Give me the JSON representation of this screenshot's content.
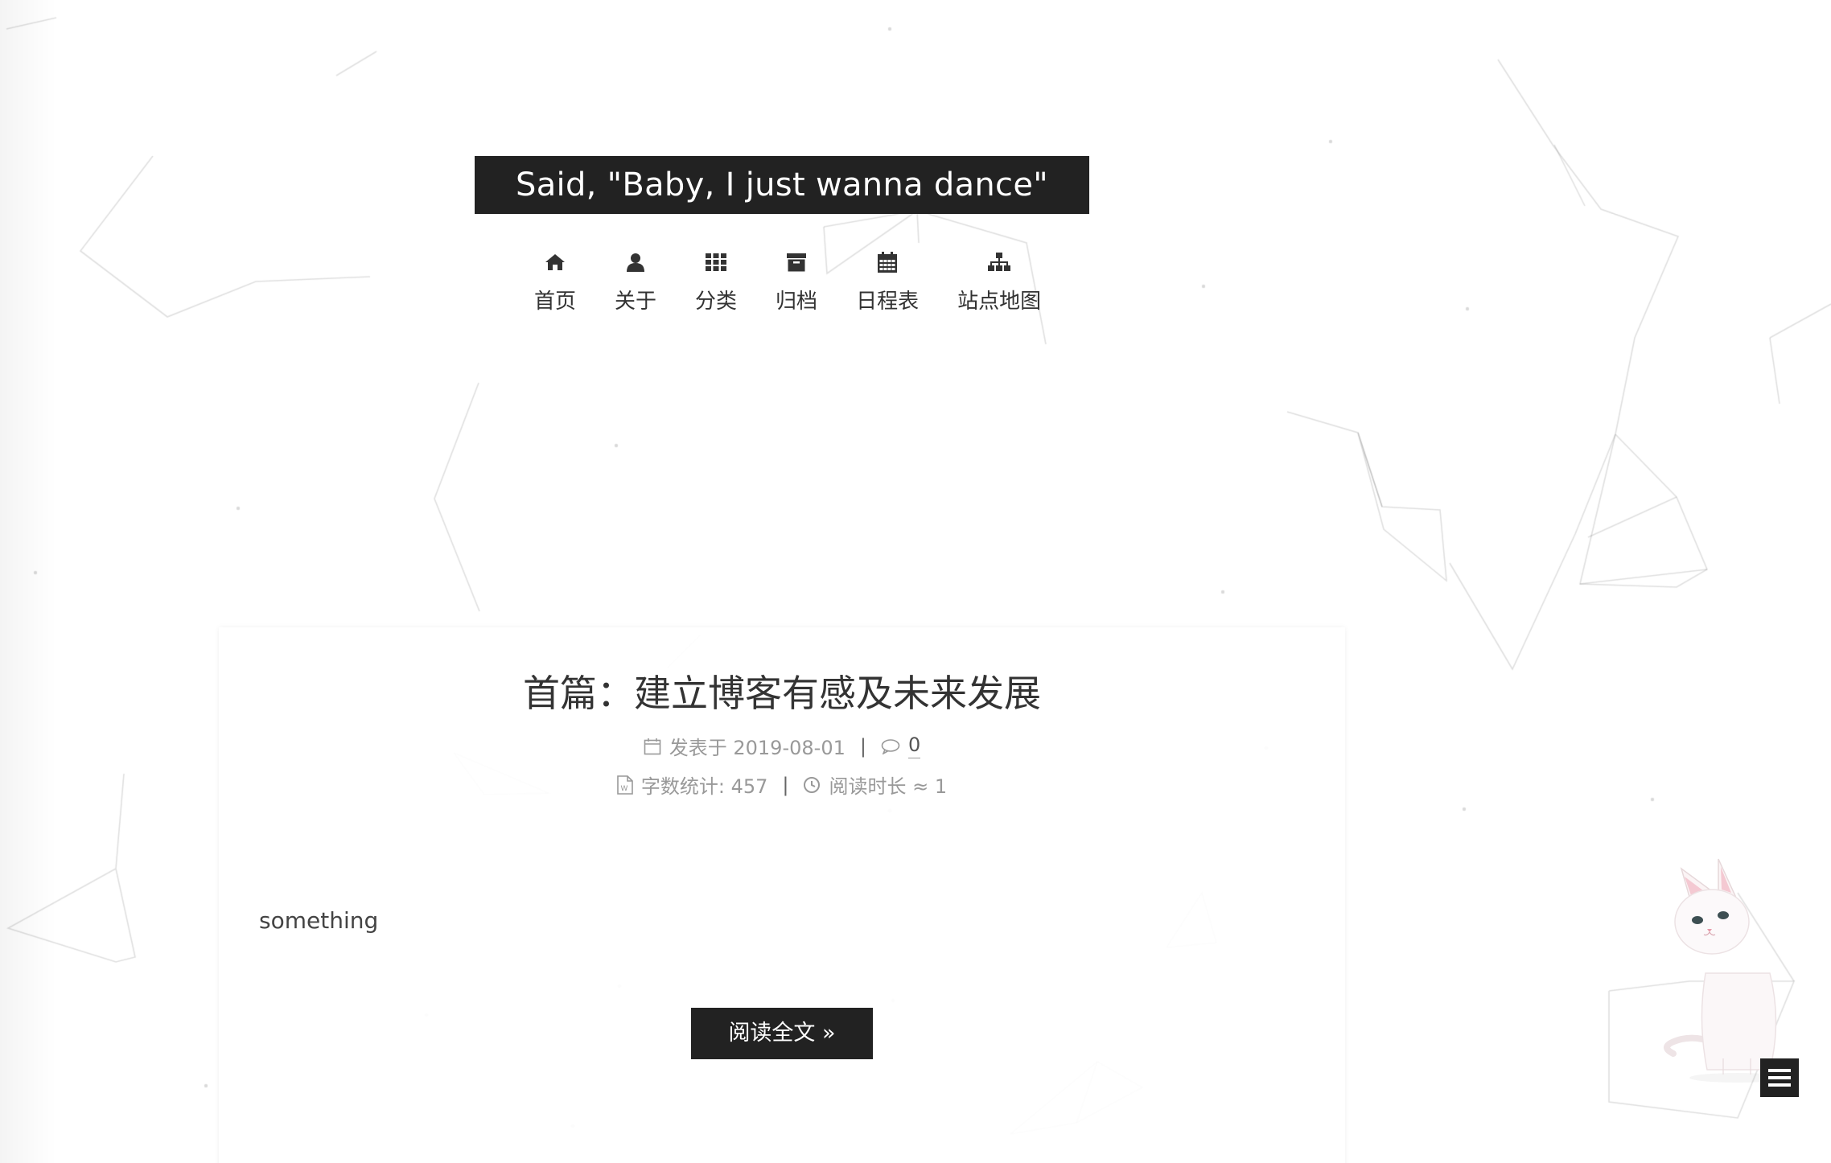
{
  "site": {
    "title": "Said, \"Baby, I just wanna dance\""
  },
  "nav": {
    "items": [
      {
        "label": "首页",
        "icon": "home-icon"
      },
      {
        "label": "关于",
        "icon": "user-icon"
      },
      {
        "label": "分类",
        "icon": "grid-icon"
      },
      {
        "label": "归档",
        "icon": "archive-icon"
      },
      {
        "label": "日程表",
        "icon": "calendar-icon"
      },
      {
        "label": "站点地图",
        "icon": "sitemap-icon"
      }
    ]
  },
  "post": {
    "title": "首篇：建立博客有感及未来发展",
    "published_label": "发表于 2019-08-01",
    "comments": "0",
    "wordcount_label": "字数统计: 457",
    "readtime_label": "阅读时长 ≈ 1",
    "excerpt": "something",
    "read_more": "阅读全文 »"
  },
  "colors": {
    "dark": "#222222",
    "text": "#333333",
    "muted": "#999999",
    "background": "#ffffff"
  }
}
